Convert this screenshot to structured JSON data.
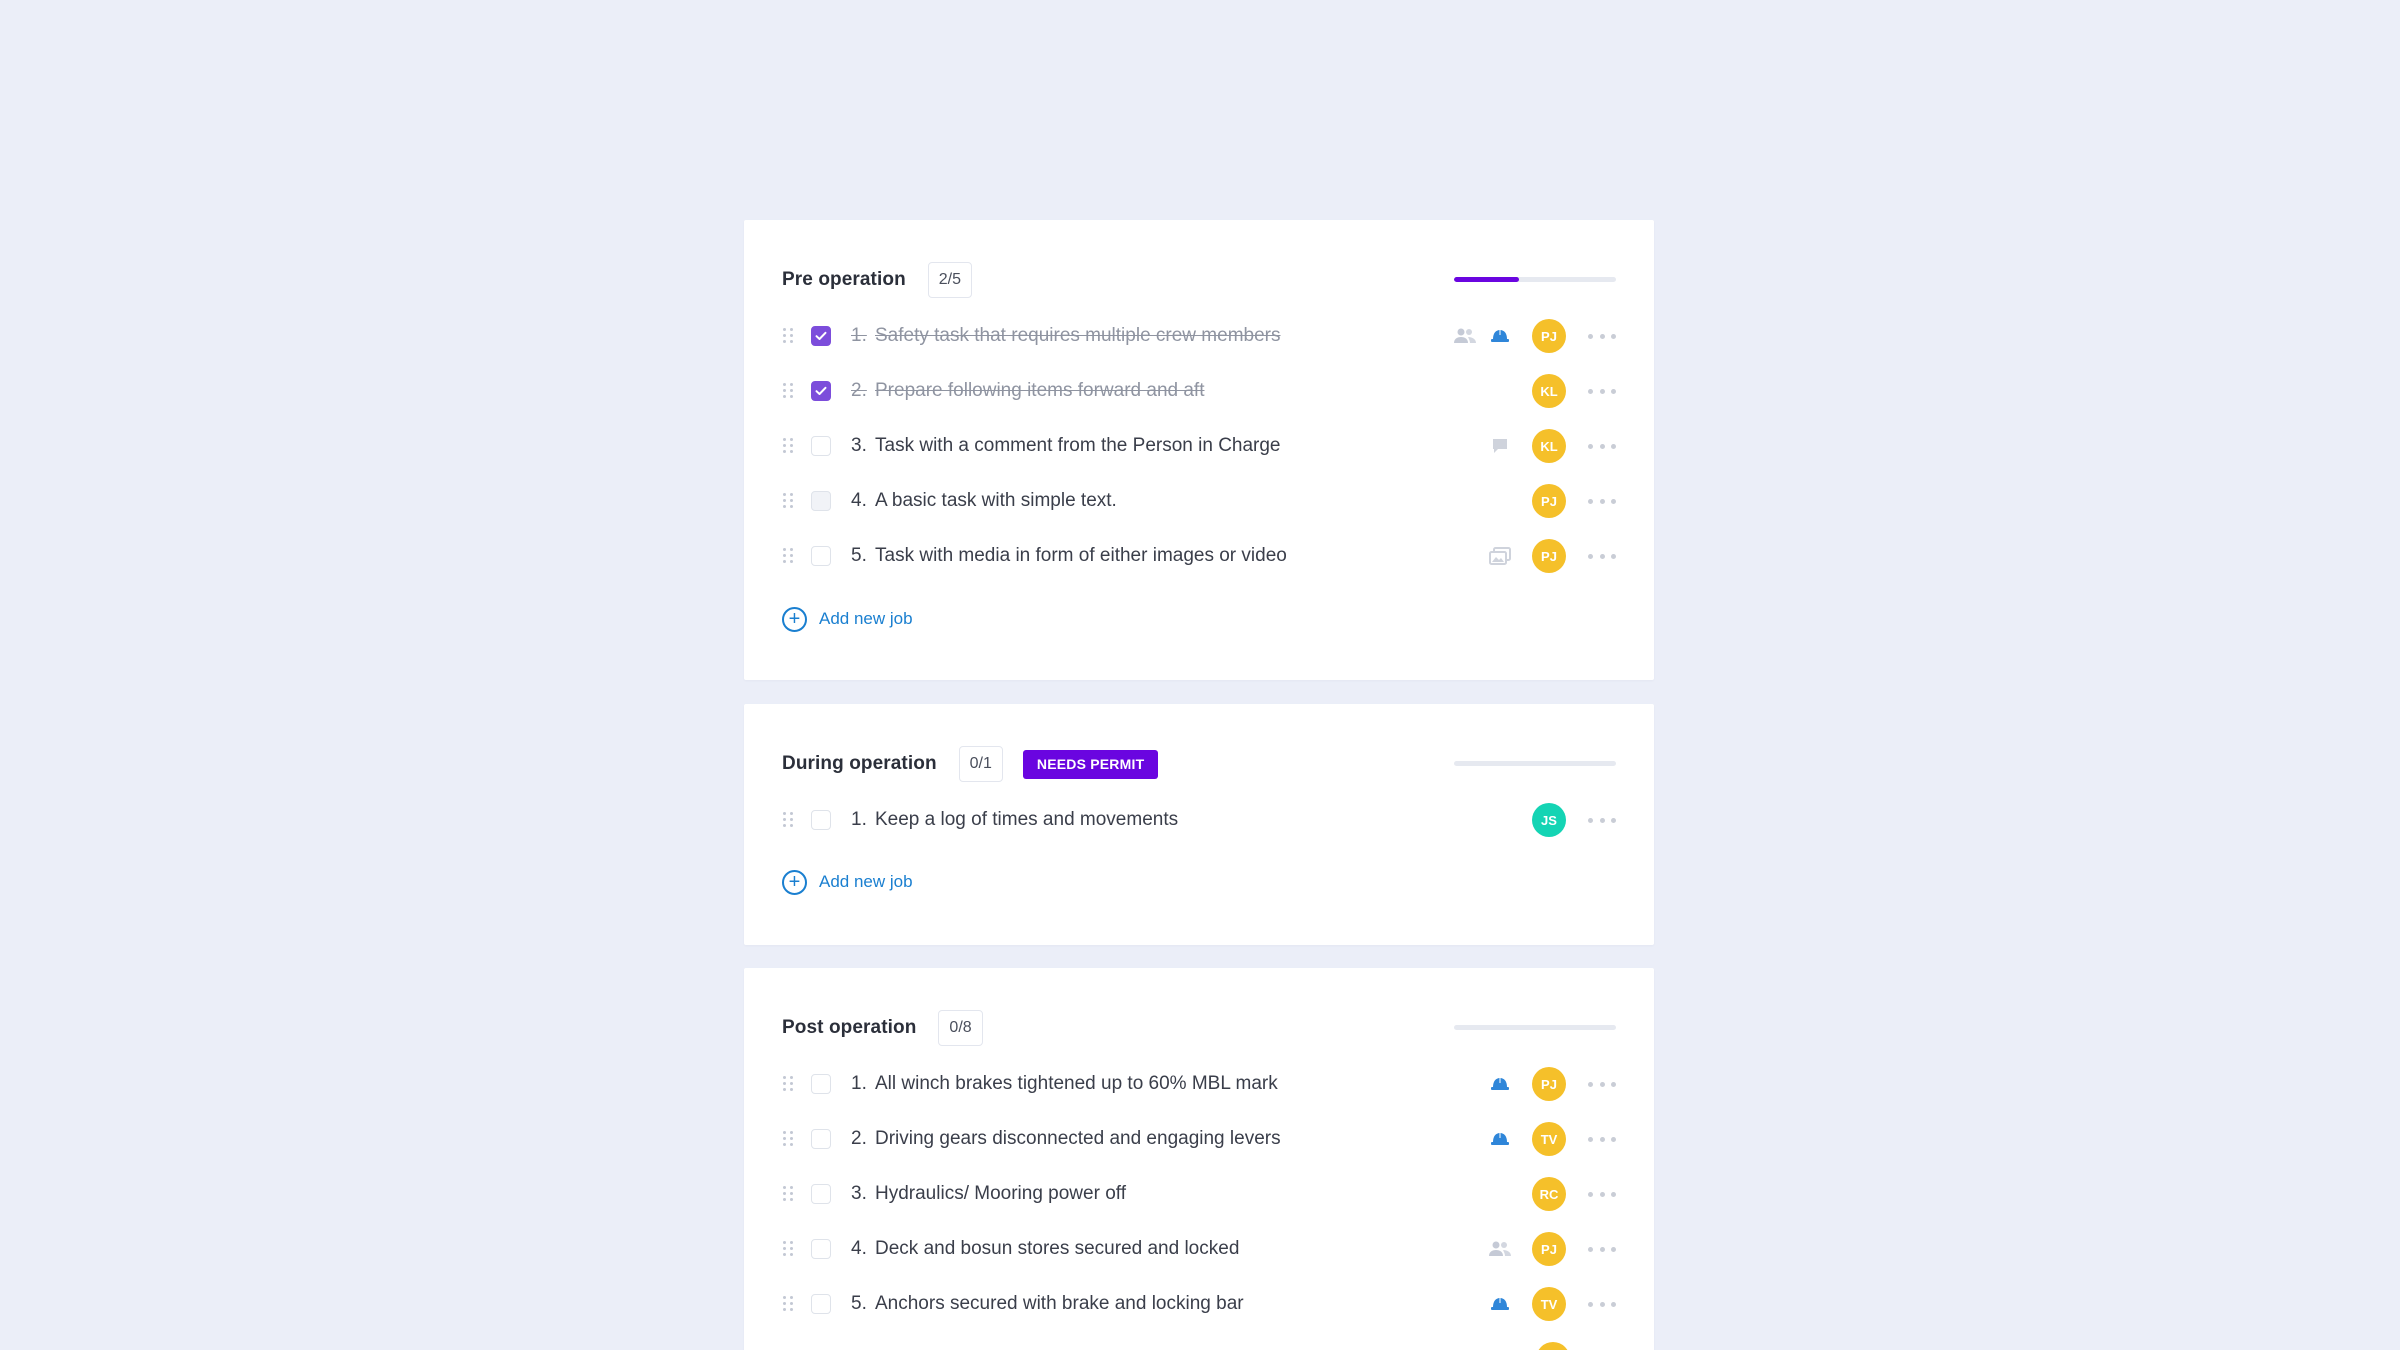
{
  "colors": {
    "background": "#ebeef8",
    "accent_purple": "#6a05e0",
    "check_purple": "#7c4ddb",
    "link_blue": "#1a7fd0",
    "avatar_yellow": "#f5c02a",
    "avatar_teal": "#14d4b4",
    "hardhat_blue": "#2f86d9"
  },
  "sections": [
    {
      "title": "Pre operation",
      "count": "2/5",
      "progress": 0.4,
      "add_label": "Add new job",
      "tasks": [
        {
          "num": "1.",
          "text": "Safety task that requires multiple crew members",
          "done": true,
          "icons": [
            "crew-icon",
            "hardhat-icon"
          ],
          "avatar": "PJ"
        },
        {
          "num": "2.",
          "text": "Prepare following items forward and aft",
          "done": true,
          "icons": [],
          "avatar": "KL"
        },
        {
          "num": "3.",
          "text": "Task with a comment from the Person in Charge",
          "done": false,
          "icons": [
            "comment-icon"
          ],
          "avatar": "KL"
        },
        {
          "num": "4.",
          "text": "A basic task with simple text.",
          "done": false,
          "icons": [],
          "avatar": "PJ"
        },
        {
          "num": "5.",
          "text": "Task with media in form of either images or video",
          "done": false,
          "icons": [
            "media-icon"
          ],
          "avatar": "PJ"
        }
      ]
    },
    {
      "title": "During operation",
      "count": "0/1",
      "permit": "NEEDS PERMIT",
      "progress": 0,
      "add_label": "Add new job",
      "tasks": [
        {
          "num": "1.",
          "text": "Keep a log of times and movements",
          "done": false,
          "icons": [],
          "avatar": "JS"
        }
      ]
    },
    {
      "title": "Post operation",
      "count": "0/8",
      "progress": 0,
      "tasks": [
        {
          "num": "1.",
          "text": "All winch brakes tightened up to 60% MBL mark",
          "done": false,
          "icons": [
            "hardhat-icon"
          ],
          "avatar": "PJ"
        },
        {
          "num": "2.",
          "text": "Driving gears disconnected and engaging levers",
          "done": false,
          "icons": [
            "hardhat-icon"
          ],
          "avatar": "TV"
        },
        {
          "num": "3.",
          "text": "Hydraulics/ Mooring power off",
          "done": false,
          "icons": [],
          "avatar": "RC"
        },
        {
          "num": "4.",
          "text": "Deck and bosun stores secured and locked",
          "done": false,
          "icons": [
            "crew-icon"
          ],
          "avatar": "PJ"
        },
        {
          "num": "5.",
          "text": "Anchors secured with brake and locking bar",
          "done": false,
          "icons": [
            "hardhat-icon"
          ],
          "avatar": "TV"
        }
      ]
    }
  ]
}
